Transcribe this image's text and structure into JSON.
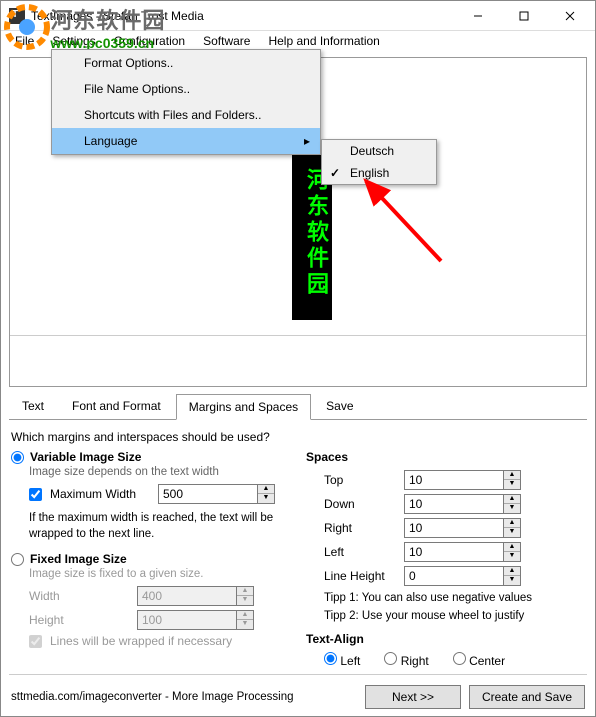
{
  "window": {
    "title": "TextImages - Stefan Trost Media"
  },
  "menu": {
    "file": "File",
    "settings": "Settings",
    "configuration": "Configuration",
    "software": "Software",
    "help": "Help and Information"
  },
  "watermark": {
    "cn": "河东软件园",
    "url": "www.pc0359.cn"
  },
  "dropdown": {
    "format": "Format Options..",
    "filename": "File Name Options..",
    "shortcuts": "Shortcuts with Files and Folders..",
    "language": "Language"
  },
  "submenu": {
    "deutsch": "Deutsch",
    "english": "English"
  },
  "preview_text": "河东软件园",
  "tabs": {
    "text": "Text",
    "font": "Font and Format",
    "margins": "Margins and Spaces",
    "save": "Save"
  },
  "question": "Which margins and interspaces should be used?",
  "left": {
    "variable": "Variable Image Size",
    "variable_sub": "Image size depends on the text width",
    "maxwidth_label": "Maximum Width",
    "maxwidth_value": "500",
    "maxwidth_note": "If the maximum width is reached, the text will be wrapped to the next line.",
    "fixed": "Fixed Image Size",
    "fixed_sub": "Image size is fixed to a given size.",
    "width_label": "Width",
    "width_value": "400",
    "height_label": "Height",
    "height_value": "100",
    "wrap": "Lines will be wrapped if necessary"
  },
  "right": {
    "spaces": "Spaces",
    "top": "Top",
    "top_v": "10",
    "down": "Down",
    "down_v": "10",
    "right": "Right",
    "right_v": "10",
    "left": "Left",
    "left_v": "10",
    "lh": "Line Height",
    "lh_v": "0",
    "tipp1": "Tipp 1: You can also use negative values",
    "tipp2": "Tipp 2: Use your mouse wheel to justify",
    "align": "Text-Align",
    "a_left": "Left",
    "a_right": "Right",
    "a_center": "Center"
  },
  "footer": {
    "link": "sttmedia.com/imageconverter - More Image Processing",
    "next": "Next >>",
    "save": "Create and Save"
  }
}
